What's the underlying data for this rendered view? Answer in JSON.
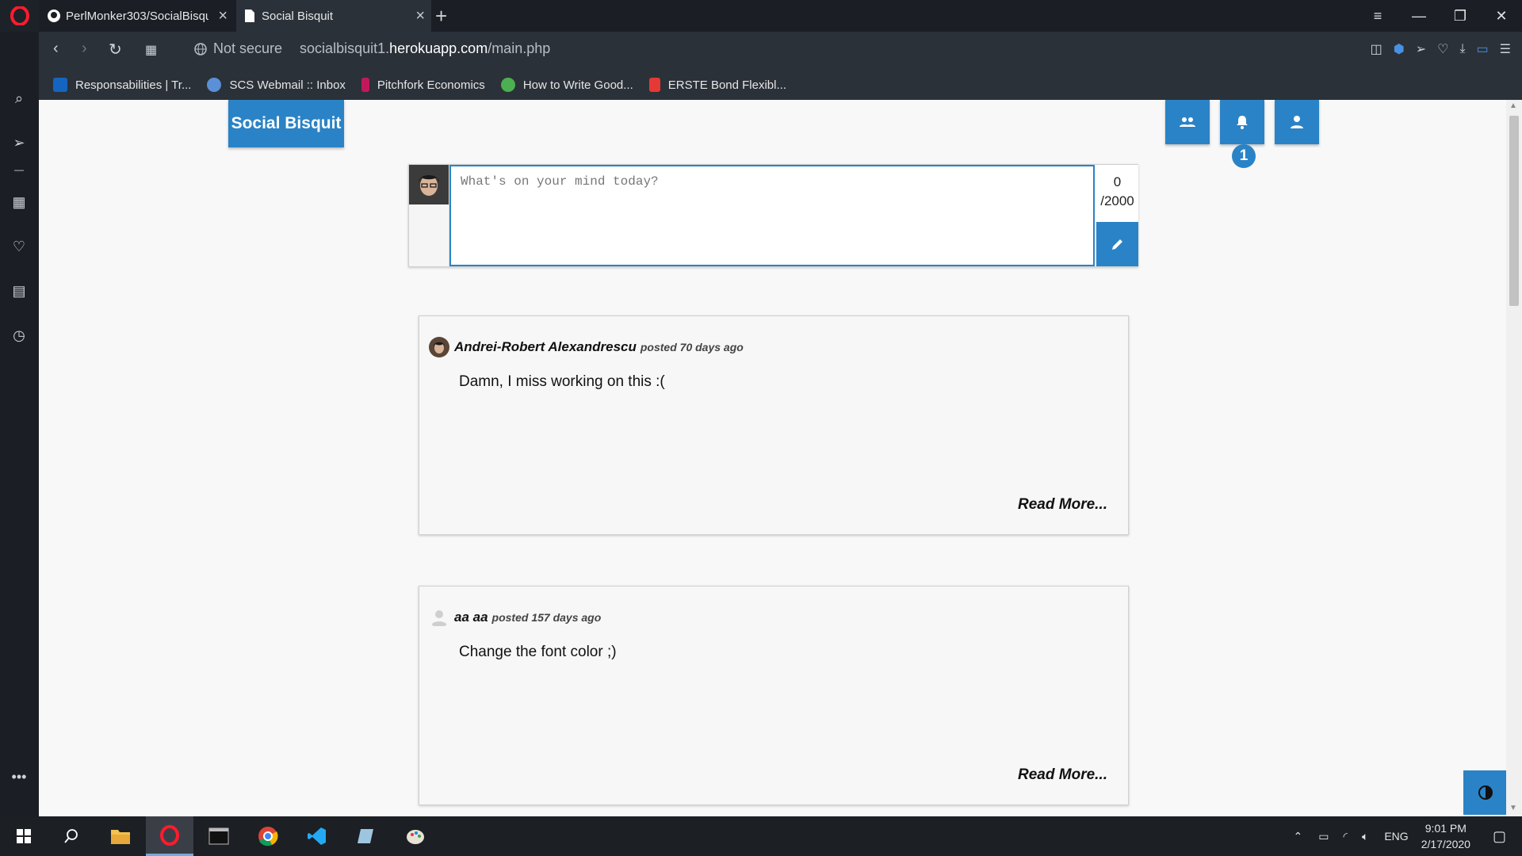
{
  "browser": {
    "tabs": [
      {
        "title": "PerlMonker303/SocialBisqu",
        "icon": "github-icon"
      },
      {
        "title": "Social Bisquit",
        "icon": "document-icon"
      }
    ],
    "new_tab_label": "+",
    "security_label": "Not secure",
    "url_prefix": "socialbisquit1.",
    "url_domain": "herokuapp.com",
    "url_path": "/main.php",
    "bookmarks": [
      {
        "label": "Responsabilities | Tr...",
        "icon": "trello-icon",
        "color": "#1565c0"
      },
      {
        "label": "SCS Webmail :: Inbox",
        "icon": "webmail-icon",
        "color": "#5b8fd6"
      },
      {
        "label": "Pitchfork Economics",
        "icon": "pitchfork-icon",
        "color": "#c2185b"
      },
      {
        "label": "How to Write Good...",
        "icon": "compass-icon",
        "color": "#4caf50"
      },
      {
        "label": "ERSTE Bond Flexibl...",
        "icon": "erste-icon",
        "color": "#e53935"
      }
    ]
  },
  "app": {
    "brand": "Social Bisquit",
    "notification_count": "1",
    "accent": "#2a83c6",
    "composer": {
      "placeholder": "What's on your mind today?",
      "count": "0",
      "max": "/2000"
    },
    "posts": [
      {
        "author": "Andrei-Robert Alexandrescu",
        "posted": "posted 70 days ago",
        "body": "Damn, I miss working on this :(",
        "read_more": "Read More..."
      },
      {
        "author": "aa aa",
        "posted": "posted 157 days ago",
        "body": "Change the font color ;)",
        "read_more": "Read More..."
      }
    ]
  },
  "taskbar": {
    "language": "ENG",
    "time": "9:01 PM",
    "date": "2/17/2020"
  }
}
